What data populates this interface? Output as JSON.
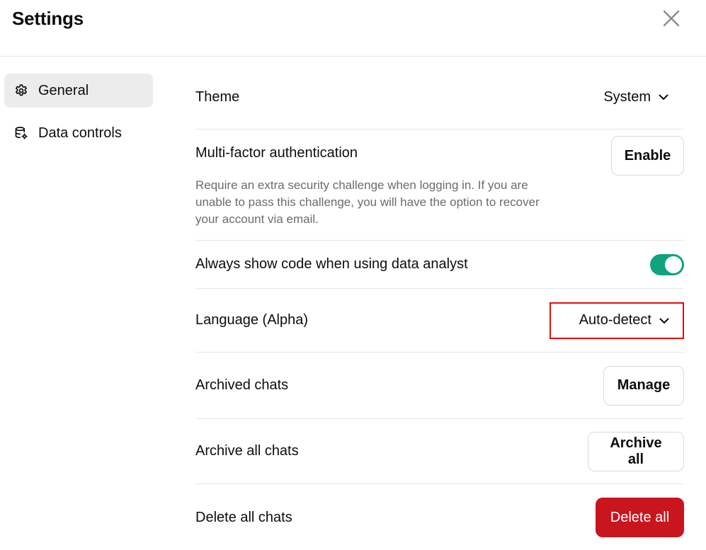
{
  "header": {
    "title": "Settings",
    "close_icon": "close-icon"
  },
  "sidebar": {
    "items": [
      {
        "label": "General",
        "icon": "gear-icon",
        "active": true
      },
      {
        "label": "Data controls",
        "icon": "database-gear-icon",
        "active": false
      }
    ]
  },
  "settings": {
    "theme": {
      "label": "Theme",
      "value": "System"
    },
    "mfa": {
      "label": "Multi-factor authentication",
      "description": "Require an extra security challenge when logging in. If you are unable to pass this challenge, you will have the option to recover your account via email.",
      "button_label": "Enable"
    },
    "code": {
      "label": "Always show code when using data analyst",
      "enabled": true
    },
    "language": {
      "label": "Language (Alpha)",
      "value": "Auto-detect"
    },
    "archived": {
      "label": "Archived chats",
      "button_label": "Manage"
    },
    "archive_all": {
      "label": "Archive all chats",
      "button_label": "Archive all"
    },
    "delete_all": {
      "label": "Delete all chats",
      "button_label": "Delete all"
    }
  },
  "colors": {
    "toggle_on": "#10a37f",
    "danger": "#c9151e",
    "highlight_box": "#e00d0d",
    "active_nav_bg": "#ececec"
  }
}
